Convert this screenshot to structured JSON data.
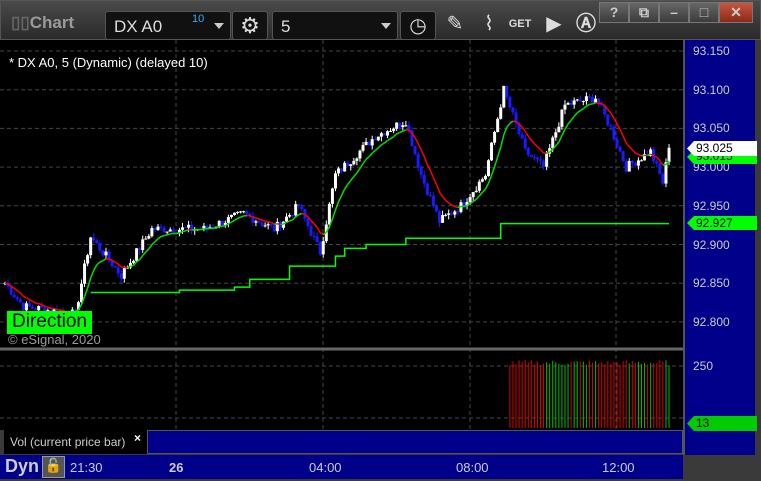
{
  "window": {
    "title": "Chart",
    "symbol": "DX A0",
    "symbol_badge": "10",
    "interval": "5",
    "buttons": [
      "?",
      "restore",
      "minimize",
      "maximize",
      "close"
    ]
  },
  "toolbar": {
    "icons": [
      "clock-icon",
      "pencil-icon",
      "line-chart-icon",
      "get-icon",
      "play-icon",
      "alert-icon"
    ]
  },
  "chart": {
    "legend": "* DX A0, 5 (Dynamic) (delayed 10)",
    "copyright": "© eSignal, 2020",
    "direction_label": "Direction",
    "price_ticks": [
      "93.150",
      "93.100",
      "93.050",
      "93.000",
      "92.950",
      "92.900",
      "92.850",
      "92.800"
    ],
    "price_tick_values": [
      93.15,
      93.1,
      93.05,
      93.0,
      92.95,
      92.9,
      92.85,
      92.8
    ],
    "last_price": "93.025",
    "ma_value": "93.015",
    "stop_value": "92.927",
    "colors": {
      "up": "#ffffff",
      "down": "#1a1aff",
      "ma_up": "#00e000",
      "ma_down": "#ff0000",
      "stop": "#00ff00",
      "axis_bg": "#00008b"
    },
    "price_path": [
      [
        0,
        92.85
      ],
      [
        6,
        92.82
      ],
      [
        23,
        92.81
      ],
      [
        28,
        92.91
      ],
      [
        38,
        92.86
      ],
      [
        48,
        92.92
      ],
      [
        65,
        92.92
      ],
      [
        78,
        92.94
      ],
      [
        88,
        92.92
      ],
      [
        96,
        92.95
      ],
      [
        103,
        92.89
      ],
      [
        108,
        92.99
      ],
      [
        121,
        93.04
      ],
      [
        131,
        93.06
      ],
      [
        136,
        92.99
      ],
      [
        142,
        92.93
      ],
      [
        149,
        92.95
      ],
      [
        157,
        92.99
      ],
      [
        163,
        93.1
      ],
      [
        170,
        93.02
      ],
      [
        176,
        93.0
      ],
      [
        183,
        93.08
      ],
      [
        193,
        93.09
      ],
      [
        198,
        93.05
      ],
      [
        203,
        93.0
      ],
      [
        211,
        93.02
      ],
      [
        215,
        92.98
      ],
      [
        217,
        93.025
      ]
    ],
    "stop_steps": [
      [
        28,
        92.838
      ],
      [
        57,
        92.841
      ],
      [
        75,
        92.845
      ],
      [
        80,
        92.855
      ],
      [
        93,
        92.872
      ],
      [
        108,
        92.885
      ],
      [
        111,
        92.895
      ],
      [
        118,
        92.9
      ],
      [
        131,
        92.908
      ],
      [
        162,
        92.927
      ],
      [
        217,
        92.927
      ]
    ]
  },
  "volume": {
    "label": "Vol (current price bar)",
    "tick": "250",
    "last": "13",
    "max": 250
  },
  "time_axis": {
    "mode": "Dyn",
    "labels": [
      "21:30",
      "26",
      "04:00",
      "08:00",
      "12:00"
    ]
  }
}
